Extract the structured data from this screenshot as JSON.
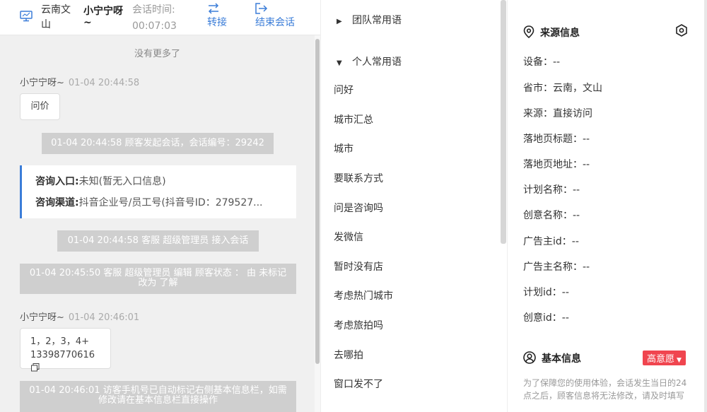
{
  "header": {
    "location": "云南文山",
    "visitor_name": "小宁宁呀~",
    "session_time_label": "会话时间:",
    "session_time": "00:07:03",
    "transfer_label": "转接",
    "end_label": "结束会话"
  },
  "chat": {
    "no_more": "没有更多了",
    "msg1_sender": "小宁宁呀~",
    "msg1_time": "01-04 20:44:58",
    "msg1_text": "问价",
    "sys1": "01-04 20:44:58 顾客发起会话，会话编号：29242",
    "entry_label": "咨询入口:",
    "entry_value": "未知(暂无入口信息)",
    "channel_label": "咨询渠道:",
    "channel_value": "抖音企业号/员工号(抖音号ID：279527...",
    "sys2": "01-04 20:44:58 客服 超级管理员 接入会话",
    "sys3": "01-04 20:45:50 客服 超级管理员 编辑 顾客状态 ： 由 未标记 改为 了解",
    "msg2_sender": "小宁宁呀~",
    "msg2_time": "01-04 20:46:01",
    "msg2_line1": "1，2，3，4+",
    "msg2_line2": "13398770616",
    "sys4": "01-04 20:46:01 访客手机号已自动标记右侧基本信息栏，如需修改请在基本信息栏直接操作"
  },
  "phrases": {
    "team_group": "团队常用语",
    "personal_group": "个人常用语",
    "items": [
      "问好",
      "城市汇总",
      "城市",
      "要联系方式",
      "问是咨询吗",
      "发微信",
      "暂时没有店",
      "考虑热门城市",
      "考虑旅拍吗",
      "去哪拍",
      "窗口发不了"
    ]
  },
  "source": {
    "title": "来源信息",
    "fields": [
      "设备：--",
      "省市：云南，文山",
      "来源：直接访问",
      "落地页标题：--",
      "落地页地址：--",
      "计划名称：--",
      "创意名称：--",
      "广告主id：--",
      "广告主名称：--",
      "计划id：--",
      "创意id：--"
    ]
  },
  "basic": {
    "title": "基本信息",
    "intent_badge": "高意愿",
    "note": "为了保障您的使用体验，会话发生当日的24点之后，顾客信息将无法修改，请及时填写"
  },
  "colors": {
    "accent": "#3b7dd8",
    "badge": "#f0454f",
    "system_message_bg": "#cfcfcf",
    "chat_bg": "#f0f0f0"
  }
}
